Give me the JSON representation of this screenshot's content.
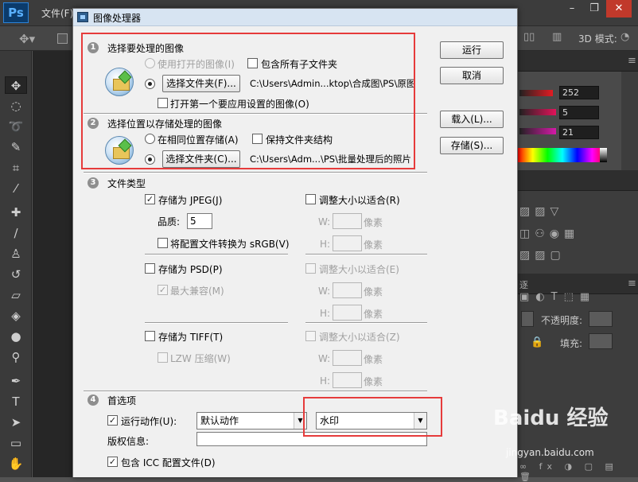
{
  "app": {
    "logo": "Ps",
    "menu_file": "文件(F)"
  },
  "window_controls": {
    "minimize": "–",
    "restore": "❐",
    "close": "✕"
  },
  "options_bar": {
    "mode_3d": "3D 模式:"
  },
  "color_panel": {
    "values": [
      "252",
      "5",
      "21"
    ],
    "slider_colors": [
      "#e31b23",
      "#e3135a",
      "#d61aa8"
    ]
  },
  "layers_panel": {
    "opacity_label": "不透明度:",
    "fill_label": "填充:"
  },
  "dialog": {
    "title": "图像处理器",
    "buttons": {
      "run": "运行",
      "cancel": "取消",
      "load": "载入(L)...",
      "save": "存储(S)..."
    },
    "section1": {
      "number": "1",
      "title": "选择要处理的图像",
      "use_open": "使用打开的图像(I)",
      "include_subfolders": "包含所有子文件夹",
      "select_folder_btn": "选择文件夹(F)...",
      "folder_path": "C:\\Users\\Admin...ktop\\合成图\\PS\\原图",
      "open_first": "打开第一个要应用设置的图像(O)"
    },
    "section2": {
      "number": "2",
      "title": "选择位置以存储处理的图像",
      "same_location": "在相同位置存储(A)",
      "keep_structure": "保持文件夹结构",
      "select_folder_btn": "选择文件夹(C)...",
      "folder_path": "C:\\Users\\Adm...\\PS\\批量处理后的照片"
    },
    "section3": {
      "number": "3",
      "title": "文件类型",
      "save_jpeg": "存储为 JPEG(J)",
      "resize_j": "调整大小以适合(R)",
      "quality_label": "品质:",
      "quality_value": "5",
      "w_label": "W:",
      "h_label": "H:",
      "px_unit": "像素",
      "convert_srgb": "将配置文件转换为 sRGB(V)",
      "save_psd": "存储为 PSD(P)",
      "resize_e": "调整大小以适合(E)",
      "max_compat": "最大兼容(M)",
      "save_tiff": "存储为 TIFF(T)",
      "resize_z": "调整大小以适合(Z)",
      "lzw": "LZW 压缩(W)"
    },
    "section4": {
      "number": "4",
      "title": "首选项",
      "run_action": "运行动作(U):",
      "action_set": "默认动作",
      "action": "水印",
      "copyright_label": "版权信息:",
      "copyright_value": "",
      "include_icc": "包含 ICC 配置文件(D)"
    }
  },
  "watermark": {
    "brand": "Baidu 经验",
    "url": "jingyan.baidu.com"
  },
  "highlight_color": "#e63b3b"
}
